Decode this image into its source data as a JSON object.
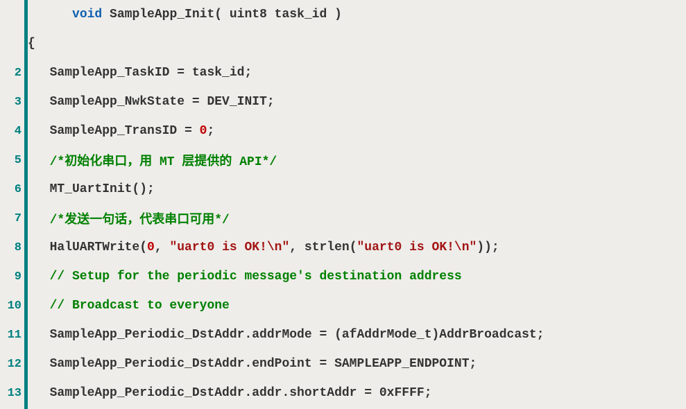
{
  "code": {
    "line1_indent": "     ",
    "line1_keyword": "void",
    "line1_rest": " SampleApp_Init( uint8 task_id )",
    "line1b": "{",
    "line2": "  SampleApp_TaskID = task_id;",
    "line3": "  SampleApp_NwkState = DEV_INIT;",
    "line4_pre": "  SampleApp_TransID = ",
    "line4_num": "0",
    "line4_post": ";",
    "line5": "  /*初始化串口，用 MT 层提供的 API*/",
    "line6": "  MT_UartInit();",
    "line7": "  /*发送一句话，代表串口可用*/",
    "line8_pre": "  HalUARTWrite(",
    "line8_num": "0",
    "line8_mid1": ", ",
    "line8_str1": "\"uart0 is OK!\\n\"",
    "line8_mid2": ", strlen(",
    "line8_str2": "\"uart0 is OK!\\n\"",
    "line8_post": "));",
    "line9": "  // Setup for the periodic message's destination address",
    "line10": "  // Broadcast to everyone",
    "line11": "  SampleApp_Periodic_DstAddr.addrMode = (afAddrMode_t)AddrBroadcast;",
    "line12": "  SampleApp_Periodic_DstAddr.endPoint = SAMPLEAPP_ENDPOINT;",
    "line13": "  SampleApp_Periodic_DstAddr.addr.shortAddr = 0xFFFF;"
  },
  "lineNumbers": {
    "l2": "2",
    "l3": "3",
    "l4": "4",
    "l5": "5",
    "l6": "6",
    "l7": "7",
    "l8": "8",
    "l9": "9",
    "l10": "10",
    "l11": "11",
    "l12": "12",
    "l13": "13"
  }
}
